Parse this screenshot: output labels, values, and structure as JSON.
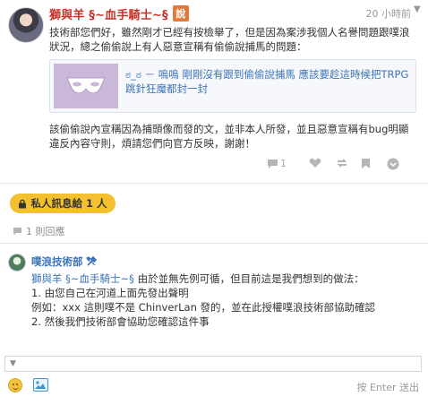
{
  "post": {
    "author": "獅與羊 §~血手騎士~§",
    "badge": "說",
    "time": "20 小時前",
    "paragraph1": "技術部您們好，雖然剛才已經有按檢舉了，但是因為案涉我個人名譽問題跟噗浪狀況，總之偷偷說上有人惡意宣稱有偷偷說捕馬的問題：",
    "link_title": "ಠ_ಠ － 嗚嗚 剛剛沒有跟到偷偷說捕馬 應該要趁這時候把TRPG跳針狂魔都封一封",
    "paragraph2": "該偷偷說內宣稱因為捕頭像而發的文，並非本人所發，並且惡意宣稱有bug明顯違反內容守則，煩請您們向官方反映，謝謝！",
    "response_count": "1"
  },
  "private_pill": "私人訊息給 1 人",
  "reply_count": "1 則回應",
  "reply": {
    "author": "噗浪技術部",
    "mention": "獅與羊 §~血手騎士~§",
    "line1_rest": " 由於並無先例可循，但目前這是我們想到的做法：",
    "line2": "1. 由您自己在河道上面先發出聲明",
    "line3": "例如：xxx 這則噗不是 ChinverLan 發的，並在此授權噗浪技術部協助確認",
    "line4": "2. 然後我們技術部會協助您確認這件事"
  },
  "composer": {
    "enter_hint": "按 Enter 送出"
  },
  "icons": [
    "chevron-down-icon",
    "comment-icon",
    "heart-icon",
    "replurk-icon",
    "bookmark-icon",
    "more-icon",
    "lock-icon",
    "reply-icon",
    "tools-icon",
    "emoji-icon",
    "image-icon"
  ],
  "colors": {
    "author": "#c8322b",
    "link": "#3d74b8",
    "pill": "#f3c130",
    "badge": "#e07a39"
  }
}
